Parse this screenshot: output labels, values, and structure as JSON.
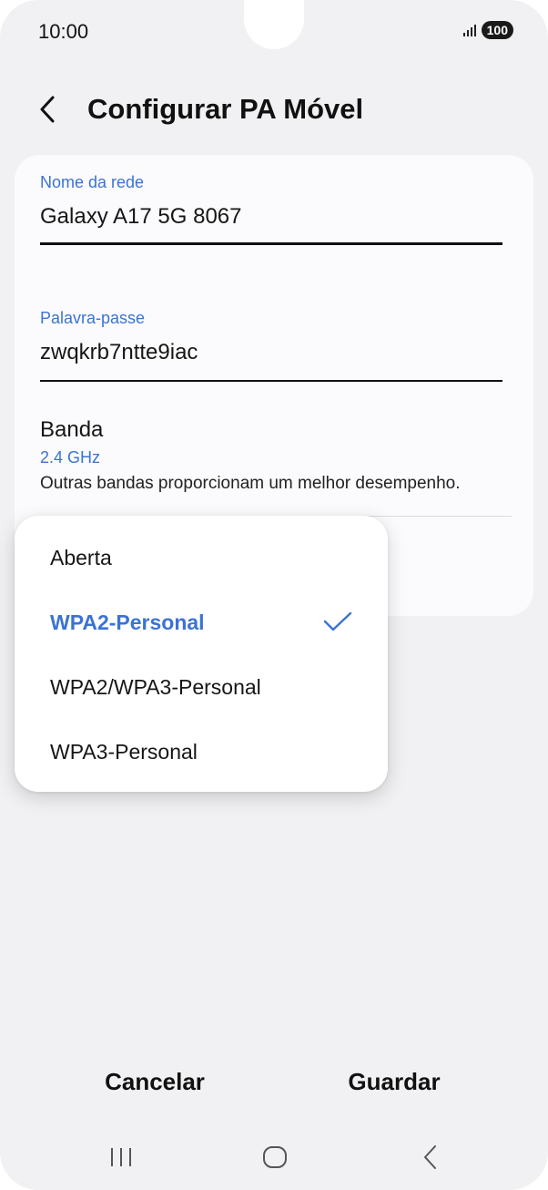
{
  "status_bar": {
    "time": "10:00",
    "battery": "100"
  },
  "header": {
    "title": "Configurar PA Móvel"
  },
  "network_name": {
    "label": "Nome da rede",
    "value": "Galaxy A17 5G 8067"
  },
  "password": {
    "label": "Palavra-passe",
    "value": "zwqkrb7ntte9iac"
  },
  "band": {
    "title": "Banda",
    "value": "2.4 GHz",
    "description": "Outras bandas proporcionam um melhor desempenho."
  },
  "security_menu": {
    "options": [
      {
        "label": "Aberta",
        "selected": false
      },
      {
        "label": "WPA2-Personal",
        "selected": true
      },
      {
        "label": "WPA2/WPA3-Personal",
        "selected": false
      },
      {
        "label": "WPA3-Personal",
        "selected": false
      }
    ]
  },
  "actions": {
    "cancel": "Cancelar",
    "save": "Guardar"
  },
  "colors": {
    "accent": "#3b73d4",
    "background": "#f1f1f3",
    "card": "#fbfbfd"
  }
}
